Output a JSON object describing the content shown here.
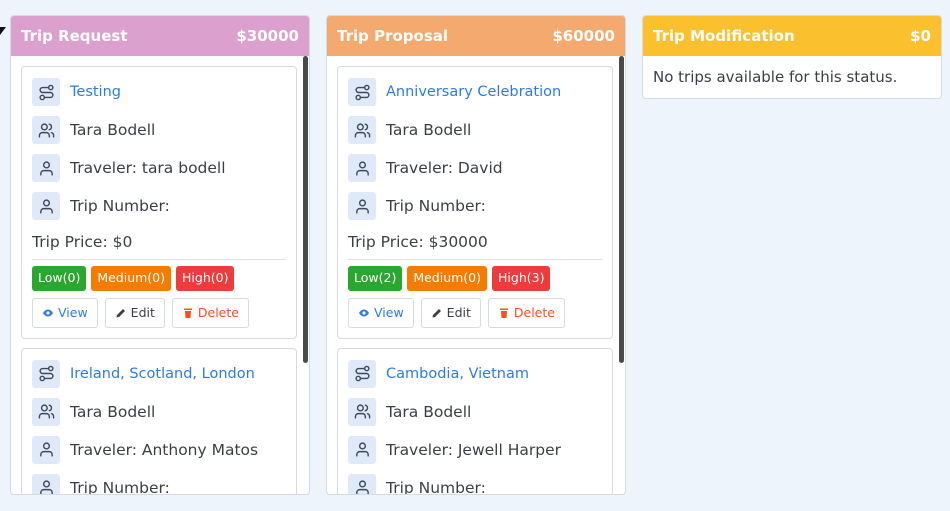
{
  "colors": {
    "request_header": "#dba0cd",
    "proposal_header": "#f4a96e",
    "modification_header": "#fbc02d",
    "link": "#2c7be5",
    "low": "#2aa72f",
    "medium": "#f57c00",
    "high": "#ef3b3b",
    "view": "#2c7be5",
    "edit": "#3b3f45",
    "delete": "#f4511e"
  },
  "columns": [
    {
      "title": "Trip Request",
      "total": "$30000",
      "cards": [
        {
          "name": "Testing",
          "client": "Tara Bodell",
          "traveler": "Traveler: tara bodell",
          "trip_number": "Trip Number:",
          "price": "Trip Price: $0",
          "low": "Low(0)",
          "medium": "Medium(0)",
          "high": "High(0)",
          "view": "View",
          "edit": "Edit",
          "delete": "Delete"
        },
        {
          "name": "Ireland, Scotland, London",
          "client": "Tara Bodell",
          "traveler": "Traveler: Anthony Matos",
          "trip_number": "Trip Number:"
        }
      ]
    },
    {
      "title": "Trip Proposal",
      "total": "$60000",
      "cards": [
        {
          "name": "Anniversary Celebration",
          "client": "Tara Bodell",
          "traveler": "Traveler: David",
          "trip_number": "Trip Number:",
          "price": "Trip Price: $30000",
          "low": "Low(2)",
          "medium": "Medium(0)",
          "high": "High(3)",
          "view": "View",
          "edit": "Edit",
          "delete": "Delete"
        },
        {
          "name": "Cambodia, Vietnam",
          "client": "Tara Bodell",
          "traveler": "Traveler: Jewell Harper",
          "trip_number": "Trip Number:"
        }
      ]
    },
    {
      "title": "Trip Modification",
      "total": "$0",
      "empty_text": "No trips available for this status."
    }
  ],
  "icons": {
    "trip": "route-icon",
    "client": "users-icon",
    "traveler": "user-icon",
    "trip_number": "user-icon",
    "view": "eye-icon",
    "edit": "pencil-icon",
    "delete": "trash-icon"
  }
}
